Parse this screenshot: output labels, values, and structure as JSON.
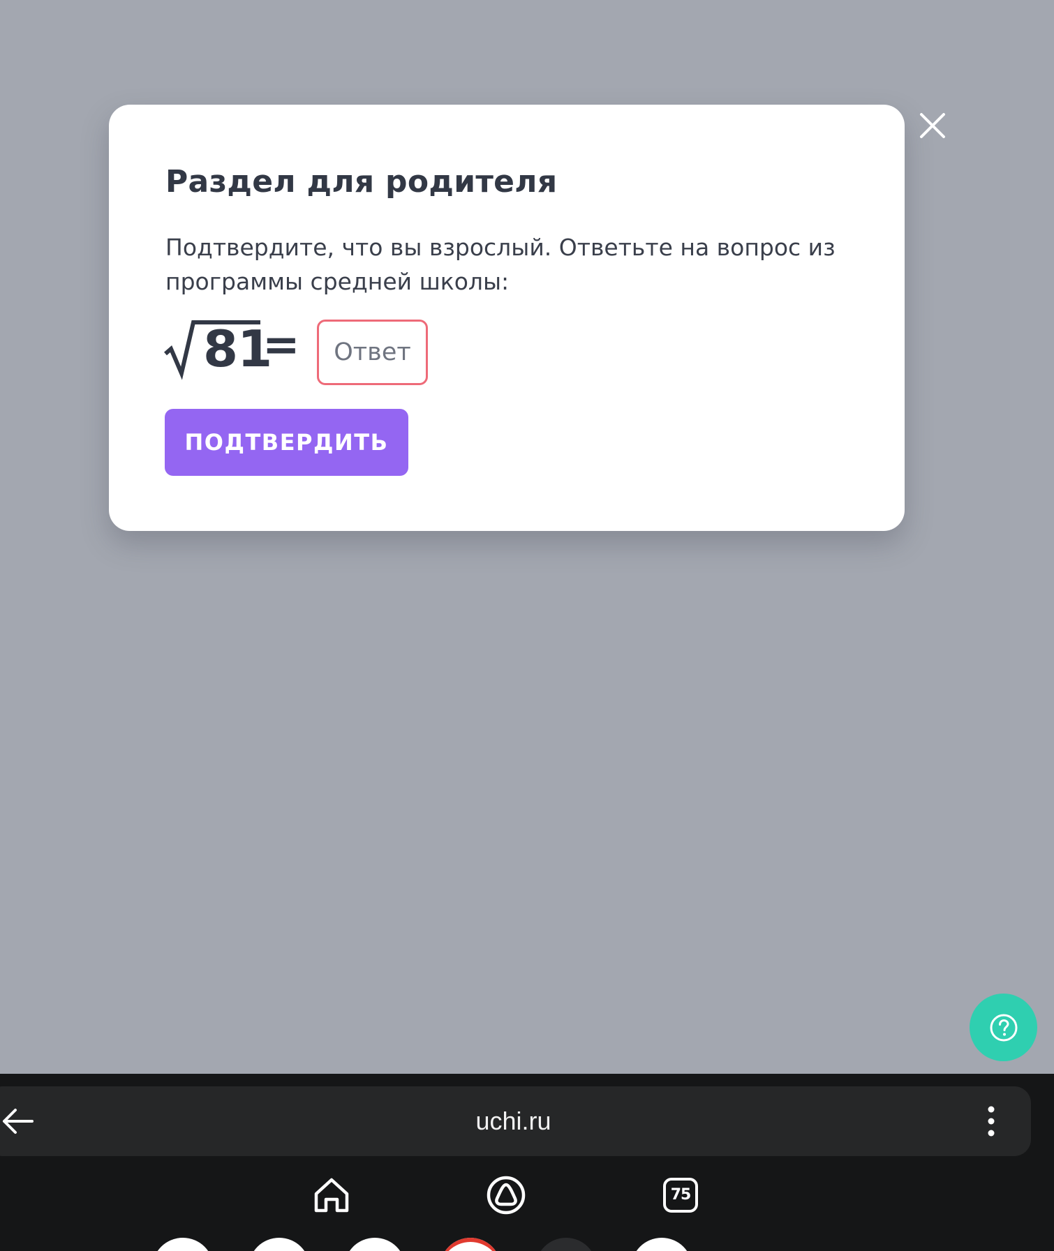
{
  "modal": {
    "title": "Раздел для родителя",
    "description": "Подтвердите, что вы взрослый. Ответьте на вопрос из программы средней школы:",
    "equation": {
      "radicand": "81",
      "equals": "="
    },
    "answer_placeholder": "Ответ",
    "answer_value": "",
    "confirm_label": "ПОДТВЕРДИТЬ",
    "close_icon": "close-icon"
  },
  "help": {
    "icon": "question-icon"
  },
  "browser": {
    "url": "uchi.ru",
    "back_icon": "arrow-left-icon",
    "menu_icon": "more-vertical-icon",
    "nav": {
      "home_icon": "home-icon",
      "assistant_icon": "alice-icon",
      "tabs_count": "75"
    }
  },
  "colors": {
    "overlay": "#a3a7b0",
    "accent": "#9466f2",
    "input_border_error": "#ee6a78",
    "help_button": "#2fcfb0",
    "browser_bar": "#151617",
    "address_bar": "#262728"
  }
}
